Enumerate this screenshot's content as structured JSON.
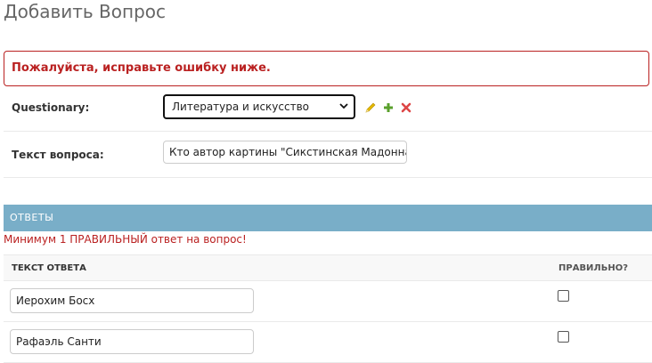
{
  "page": {
    "title": "Добавить Вопрос",
    "error_note": "Пожалуйста, исправьте ошибку ниже."
  },
  "form": {
    "questionary": {
      "label": "Questionary:",
      "selected": "Литература и искусство",
      "icons": [
        "edit-pencil-icon",
        "add-plus-icon",
        "delete-x-icon"
      ]
    },
    "question_text": {
      "label": "Текст вопроса:",
      "value": "Кто автор картины \"Сикстинская Мадонна"
    }
  },
  "inline": {
    "header": "ОТВЕТЫ",
    "error": "Минимум 1 ПРАВИЛЬНЫЙ ответ на вопрос!",
    "columns": {
      "answer": "ТЕКСТ ОТВЕТА",
      "correct": "ПРАВИЛЬНО?"
    },
    "rows": [
      {
        "answer": "Иерохим Босх",
        "correct": false
      },
      {
        "answer": "Рафаэль Санти",
        "correct": false
      }
    ]
  },
  "colors": {
    "error": "#ba2121",
    "inline_header_bg": "#79aec8",
    "pencil": "#e6b800",
    "plus": "#5aa02c",
    "delete": "#dd4646"
  }
}
